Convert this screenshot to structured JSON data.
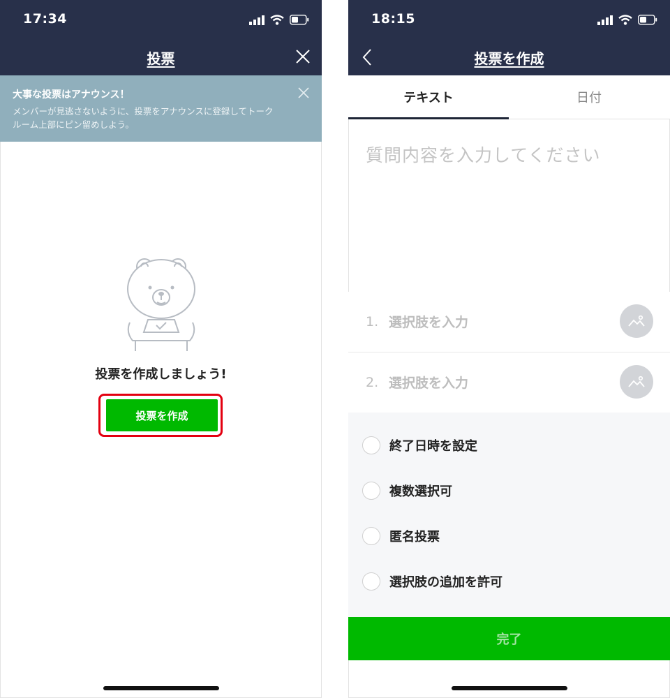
{
  "left": {
    "status": {
      "time": "17:34"
    },
    "nav": {
      "title": "投票"
    },
    "banner": {
      "title": "大事な投票はアナウンス！",
      "text": "メンバーが見逃さないように、投票をアナウンスに登録してトークルーム上部にピン留めしよう。"
    },
    "empty": {
      "message": "投票を作成しましょう!",
      "button_label": "投票を作成"
    },
    "colors": {
      "header": "#28304a",
      "banner": "#90afbc",
      "button": "#00b900",
      "highlight": "#e30010"
    }
  },
  "right": {
    "status": {
      "time": "18:15"
    },
    "nav": {
      "title": "投票を作成"
    },
    "tabs": [
      {
        "label": "テキスト"
      },
      {
        "label": "日付"
      }
    ],
    "question_placeholder": "質問内容を入力してください",
    "options": [
      {
        "number": "1.",
        "placeholder": "選択肢を入力"
      },
      {
        "number": "2.",
        "placeholder": "選択肢を入力"
      }
    ],
    "settings": [
      {
        "label": "終了日時を設定"
      },
      {
        "label": "複数選択可"
      },
      {
        "label": "匿名投票"
      },
      {
        "label": "選択肢の追加を許可"
      }
    ],
    "done_label": "完了"
  }
}
